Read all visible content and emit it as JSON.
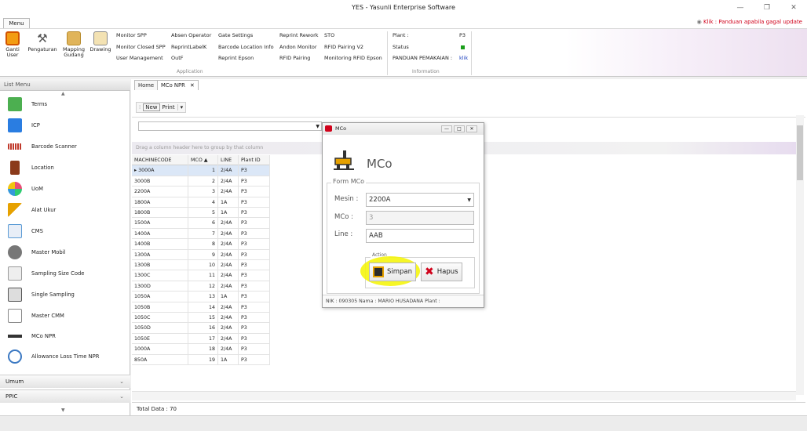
{
  "window": {
    "title": "YES - Yasunli Enterprise Software",
    "minimize": "—",
    "restore": "❐",
    "close": "✕"
  },
  "menu_tab": "Menu",
  "help_link": "Klik : Panduan apabila gagal update",
  "ribbon": {
    "big_buttons": [
      {
        "label": "Ganti User",
        "icon": "user-switch-icon"
      },
      {
        "label": "Pengaturan",
        "icon": "settings-wrench-icon"
      },
      {
        "label": "Mapping Gudang",
        "icon": "warehouse-map-icon"
      },
      {
        "label": "Drawing",
        "icon": "drawing-icon"
      }
    ],
    "commands": [
      [
        "Monitor SPP",
        "Absen Operator",
        "Gate Settings",
        "Reprint Rework",
        "STO"
      ],
      [
        "Monitor Closed SPP",
        "ReprintLabelK",
        "Barcode Location Info",
        "Andon Monitor",
        "RFID Pairing V2"
      ],
      [
        "User Management",
        "OutF",
        "Reprint Epson",
        "RFID Pairing",
        "Monitoring RFID Epson"
      ]
    ],
    "group_application": "Application",
    "info": {
      "plant_label": "Plant :",
      "plant_value": "P3",
      "status_label": "Status",
      "panduan_label": "PANDUAN PEMAKAIAN :",
      "panduan_link": "klik",
      "group": "Information"
    }
  },
  "sidebar": {
    "header": "List Menu",
    "items": [
      {
        "label": "Terms",
        "icon": "terms-icon",
        "color": "#4caf50"
      },
      {
        "label": "ICP",
        "icon": "book-icon",
        "color": "#2a7de1"
      },
      {
        "label": "Barcode Scanner",
        "icon": "barcode-icon",
        "color": "#c0392b"
      },
      {
        "label": "Location",
        "icon": "door-icon",
        "color": "#8b3a1a"
      },
      {
        "label": "UoM",
        "icon": "uom-icon",
        "color": "#e94e77"
      },
      {
        "label": "Alat Ukur",
        "icon": "ruler-icon",
        "color": "#e6a100"
      },
      {
        "label": "CMS",
        "icon": "cms-icon",
        "color": "#5b9bd5"
      },
      {
        "label": "Master Mobil",
        "icon": "car-icon",
        "color": "#777777"
      },
      {
        "label": "Sampling Size Code",
        "icon": "sampling-icon",
        "color": "#999999"
      },
      {
        "label": "Single Sampling",
        "icon": "printer-icon",
        "color": "#555555"
      },
      {
        "label": "Master CMM",
        "icon": "cmm-icon",
        "color": "#888888"
      },
      {
        "label": "MCo NPR",
        "icon": "machine-icon",
        "color": "#333333"
      },
      {
        "label": "Allowance Loss Time NPR",
        "icon": "clock-icon",
        "color": "#3a78c2"
      }
    ],
    "sections": [
      "Umum",
      "PPIC"
    ]
  },
  "tabs": [
    "Home",
    "MCo NPR"
  ],
  "tab_close": "✕",
  "toolbar": {
    "new": "New",
    "print": "Print",
    "dropdown": "▾"
  },
  "group_hint": "Drag a column header here to group by that column",
  "grid": {
    "columns": [
      "MACHINECODE",
      "MCO",
      "LINE",
      "Plant ID"
    ],
    "sort_indicator": "▲",
    "rows": [
      [
        "3000A",
        "1",
        "2/4A",
        "P3"
      ],
      [
        "3000B",
        "2",
        "2/4A",
        "P3"
      ],
      [
        "2200A",
        "3",
        "2/4A",
        "P3"
      ],
      [
        "1800A",
        "4",
        "1A",
        "P3"
      ],
      [
        "1800B",
        "5",
        "1A",
        "P3"
      ],
      [
        "1500A",
        "6",
        "2/4A",
        "P3"
      ],
      [
        "1400A",
        "7",
        "2/4A",
        "P3"
      ],
      [
        "1400B",
        "8",
        "2/4A",
        "P3"
      ],
      [
        "1300A",
        "9",
        "2/4A",
        "P3"
      ],
      [
        "1300B",
        "10",
        "2/4A",
        "P3"
      ],
      [
        "1300C",
        "11",
        "2/4A",
        "P3"
      ],
      [
        "1300D",
        "12",
        "2/4A",
        "P3"
      ],
      [
        "1050A",
        "13",
        "1A",
        "P3"
      ],
      [
        "1050B",
        "14",
        "2/4A",
        "P3"
      ],
      [
        "1050C",
        "15",
        "2/4A",
        "P3"
      ],
      [
        "1050D",
        "16",
        "2/4A",
        "P3"
      ],
      [
        "1050E",
        "17",
        "2/4A",
        "P3"
      ],
      [
        "1000A",
        "18",
        "2/4A",
        "P3"
      ],
      [
        "850A",
        "19",
        "1A",
        "P3"
      ]
    ]
  },
  "status": {
    "total": "Total Data : 70"
  },
  "dialog": {
    "title": "MCo",
    "heading": "MCo",
    "form_legend": "Form MCo",
    "mesin_label": "Mesin :",
    "mesin_value": "2200A",
    "mco_label": "MCo :",
    "mco_value": "3",
    "line_label": "Line :",
    "line_value": "AAB",
    "action_legend": "Action",
    "save_label": "Simpan",
    "delete_label": "Hapus",
    "status": "NIK : 090305 Nama : MARIO HUSADANA Plant :",
    "btn_min": "—",
    "btn_max": "□",
    "btn_close": "✕"
  }
}
